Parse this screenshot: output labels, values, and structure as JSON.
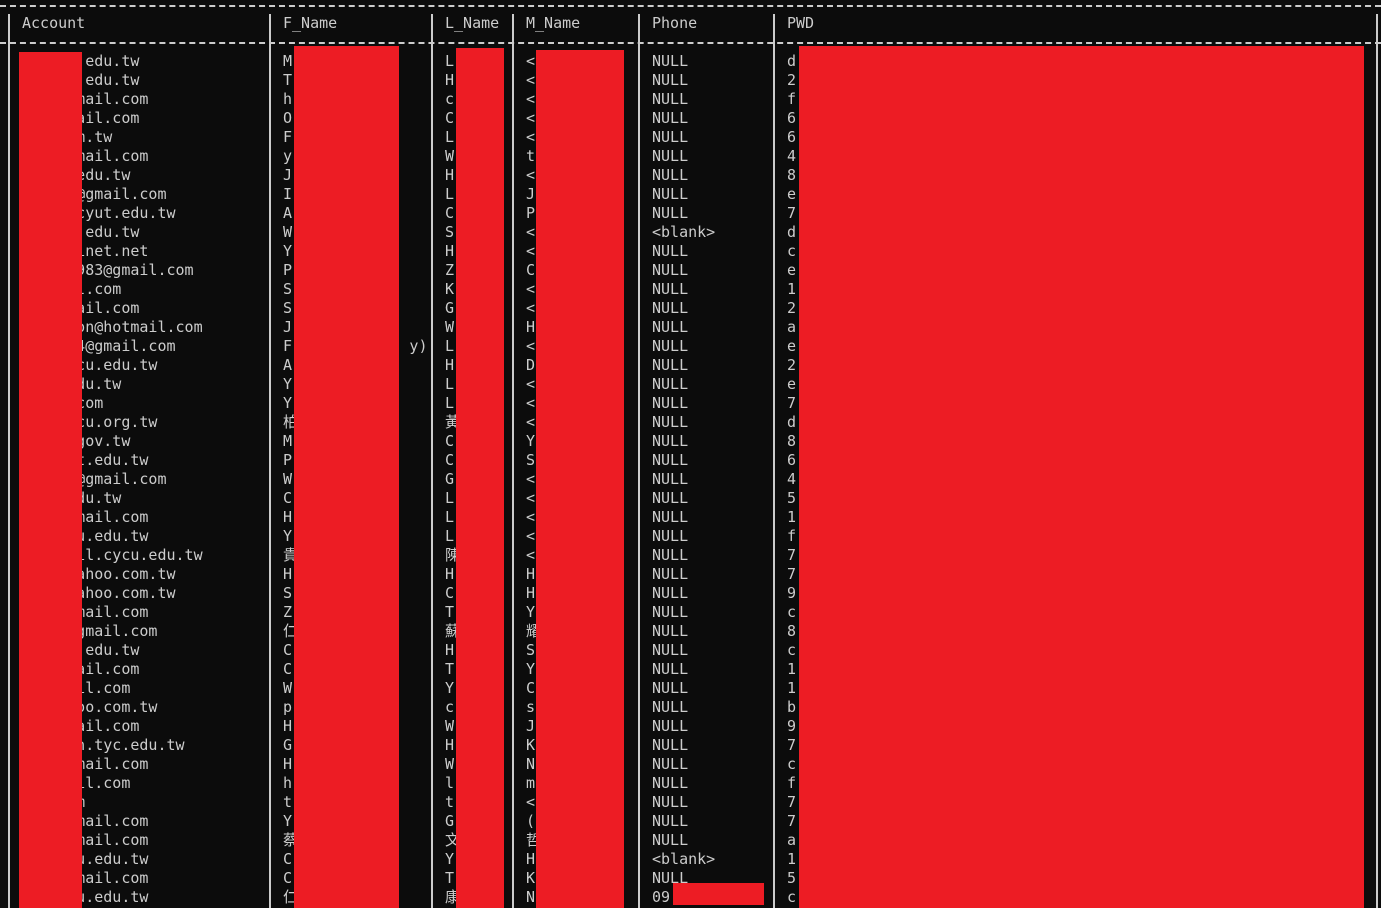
{
  "table": {
    "headers": {
      "account": "Account",
      "f_name": "F_Name",
      "l_name": "L_Name",
      "m_name": "M_Name",
      "phone": "Phone",
      "pwd": "PWD"
    },
    "rows": [
      {
        "account": "n@cycu.edu.tw",
        "f_name": "M",
        "l_name": "L",
        "m_name": "<",
        "phone": "NULL",
        "pwd": "d"
      },
      {
        "account": "g@cycu.edu.tw",
        "f_name": "T",
        "l_name": "H",
        "m_name": "<",
        "phone": "NULL",
        "pwd": "2"
      },
      {
        "account": "5733@gmail.com",
        "f_name": "h",
        "l_name": "c",
        "m_name": "<",
        "phone": "NULL",
        "pwd": "f"
      },
      {
        "account": "201@gmail.com",
        "f_name": "O",
        "l_name": "C",
        "m_name": "<",
        "phone": "NULL",
        "pwd": "6"
      },
      {
        "account": "cpc.com.tw",
        "f_name": "F",
        "l_name": "L",
        "m_name": "<",
        "phone": "NULL",
        "pwd": "6"
      },
      {
        "account": "1426@gmail.com",
        "f_name": "y",
        "l_name": "W",
        "m_name": "t",
        "phone": "NULL",
        "pwd": "4"
      },
      {
        "account": "g@uch.edu.tw",
        "f_name": "J",
        "l_name": "H",
        "m_name": "<",
        "phone": "NULL",
        "pwd": "8"
      },
      {
        "account": "lo1688@gmail.com",
        "f_name": "I",
        "l_name": "L",
        "m_name": "J",
        "phone": "NULL",
        "pwd": "e"
      },
      {
        "account": "en@gm.cyut.edu.tw",
        "f_name": "A",
        "l_name": "C",
        "m_name": "P",
        "phone": "NULL",
        "pwd": "7"
      },
      {
        "account": "n@cycu.edu.tw",
        "f_name": "W",
        "l_name": "S",
        "m_name": "<",
        "phone": "<blank>",
        "pwd": "d"
      },
      {
        "account": "ms12.hinet.net",
        "f_name": "Y",
        "l_name": "H",
        "m_name": "<",
        "phone": "NULL",
        "pwd": "c"
      },
      {
        "account": "engtw1983@gmail.com",
        "f_name": "P",
        "l_name": "Z",
        "m_name": "C",
        "phone": "NULL",
        "pwd": "e"
      },
      {
        "account": "o@gmail.com",
        "f_name": "S",
        "l_name": "K",
        "m_name": "<",
        "phone": "NULL",
        "pwd": "1"
      },
      {
        "account": "718@gmail.com",
        "f_name": "S",
        "l_name": "G",
        "m_name": "<",
        "phone": "NULL",
        "pwd": "2"
      },
      {
        "account": "onponpon@hotmail.com",
        "f_name": "J",
        "l_name": "W",
        "m_name": "H",
        "phone": "NULL",
        "pwd": "a"
      },
      {
        "account": "ush0224@gmail.com",
        "f_name": "F             y)",
        "l_name": "L",
        "m_name": "<",
        "phone": "NULL",
        "pwd": "e"
      },
      {
        "account": "510@cycu.edu.tw",
        "f_name": "A",
        "l_name": "H",
        "m_name": "D",
        "phone": "NULL",
        "pwd": "2"
      },
      {
        "account": "cute.edu.tw",
        "f_name": "Y",
        "l_name": "L",
        "m_name": "<",
        "phone": "NULL",
        "pwd": "e"
      },
      {
        "account": "4@163.com",
        "f_name": "Y",
        "l_name": "L",
        "m_name": "<",
        "phone": "NULL",
        "pwd": "7"
      },
      {
        "account": "916@cycu.org.tw",
        "f_name": "柏",
        "l_name": "黃",
        "m_name": "<",
        "phone": "NULL",
        "pwd": "d"
      },
      {
        "account": "6@nhi.gov.tw",
        "f_name": "M",
        "l_name": "C",
        "m_name": "Y",
        "phone": "NULL",
        "pwd": "8"
      },
      {
        "account": "en@cyut.edu.tw",
        "f_name": "P",
        "l_name": "C",
        "m_name": "S",
        "phone": "NULL",
        "pwd": "6"
      },
      {
        "account": "ve2009@gmail.com",
        "f_name": "W",
        "l_name": "G",
        "m_name": "<",
        "phone": "NULL",
        "pwd": "4"
      },
      {
        "account": "cycu.edu.tw",
        "f_name": "C",
        "l_name": "L",
        "m_name": "<",
        "phone": "NULL",
        "pwd": "5"
      },
      {
        "account": "an65@gmail.com",
        "f_name": "H",
        "l_name": "L",
        "m_name": "<",
        "phone": "NULL",
        "pwd": "1"
      },
      {
        "account": "li@cycu.edu.tw",
        "f_name": "Y",
        "l_name": "L",
        "m_name": "<",
        "phone": "NULL",
        "pwd": "f"
      },
      {
        "account": "504@mail.cycu.edu.tw",
        "f_name": "貴",
        "l_name": "陳",
        "m_name": "<",
        "phone": "NULL",
        "pwd": "7"
      },
      {
        "account": "_shu@yahoo.com.tw",
        "f_name": "H",
        "l_name": "H",
        "m_name": "H",
        "phone": "NULL",
        "pwd": "7"
      },
      {
        "account": "oria@yahoo.com.tw",
        "f_name": "S",
        "l_name": "C",
        "m_name": "H",
        "phone": "NULL",
        "pwd": "9"
      },
      {
        "account": "1727@gmail.com",
        "f_name": "Z",
        "l_name": "T",
        "m_name": "Y",
        "phone": "NULL",
        "pwd": "c"
      },
      {
        "account": "d2012@gmail.com",
        "f_name": "仁",
        "l_name": "蘇",
        "m_name": "耀",
        "phone": "NULL",
        "pwd": "8"
      },
      {
        "account": "ms.tyc.edu.tw",
        "f_name": "C",
        "l_name": "H",
        "m_name": "S",
        "phone": "NULL",
        "pwd": "c"
      },
      {
        "account": "6ta@gmail.com",
        "f_name": "C",
        "l_name": "T",
        "m_name": "Y",
        "phone": "NULL",
        "pwd": "1"
      },
      {
        "account": "17@gmail.com",
        "f_name": "W",
        "l_name": "Y",
        "m_name": "C",
        "phone": "NULL",
        "pwd": "1"
      },
      {
        "account": "en@yahoo.com.tw",
        "f_name": "p",
        "l_name": "c",
        "m_name": "s",
        "phone": "NULL",
        "pwd": "b"
      },
      {
        "account": "lin@gmail.com",
        "f_name": "H",
        "l_name": "W",
        "m_name": "J",
        "phone": "NULL",
        "pwd": "9"
      },
      {
        "account": "15@lkjh.tyc.edu.tw",
        "f_name": "G",
        "l_name": "H",
        "m_name": "K",
        "phone": "NULL",
        "pwd": "7"
      },
      {
        "account": "g911@gmail.com",
        "f_name": "H",
        "l_name": "W",
        "m_name": "N",
        "phone": "NULL",
        "pwd": "c"
      },
      {
        "account": "42@gmail.com",
        "f_name": "h",
        "l_name": "l",
        "m_name": "m",
        "phone": "NULL",
        "pwd": "f"
      },
      {
        "account": "ail.com",
        "f_name": "t",
        "l_name": "t",
        "m_name": "<",
        "phone": "NULL",
        "pwd": "7"
      },
      {
        "account": "3096@gmail.com",
        "f_name": "Y",
        "l_name": "G",
        "m_name": "(",
        "phone": "NULL",
        "pwd": "7"
      },
      {
        "account": "tsai@gmail.com",
        "f_name": "蔡",
        "l_name": "文",
        "m_name": "哲",
        "phone": "NULL",
        "pwd": "a"
      },
      {
        "account": "004@ntu.edu.tw",
        "f_name": "C",
        "l_name": "Y",
        "m_name": "H",
        "phone": "<blank>",
        "pwd": "1"
      },
      {
        "account": "tsai@gmail.com",
        "f_name": "C",
        "l_name": "T",
        "m_name": "K",
        "phone": "NULL",
        "pwd": "5"
      },
      {
        "account": "001@ntu.edu.tw",
        "f_name": "仁",
        "l_name": "康",
        "m_name": "N",
        "phone": "09",
        "pwd": "c"
      }
    ]
  },
  "colors": {
    "background": "#0c0c0c",
    "text": "#cccccc",
    "redaction": "#ed1c24"
  }
}
